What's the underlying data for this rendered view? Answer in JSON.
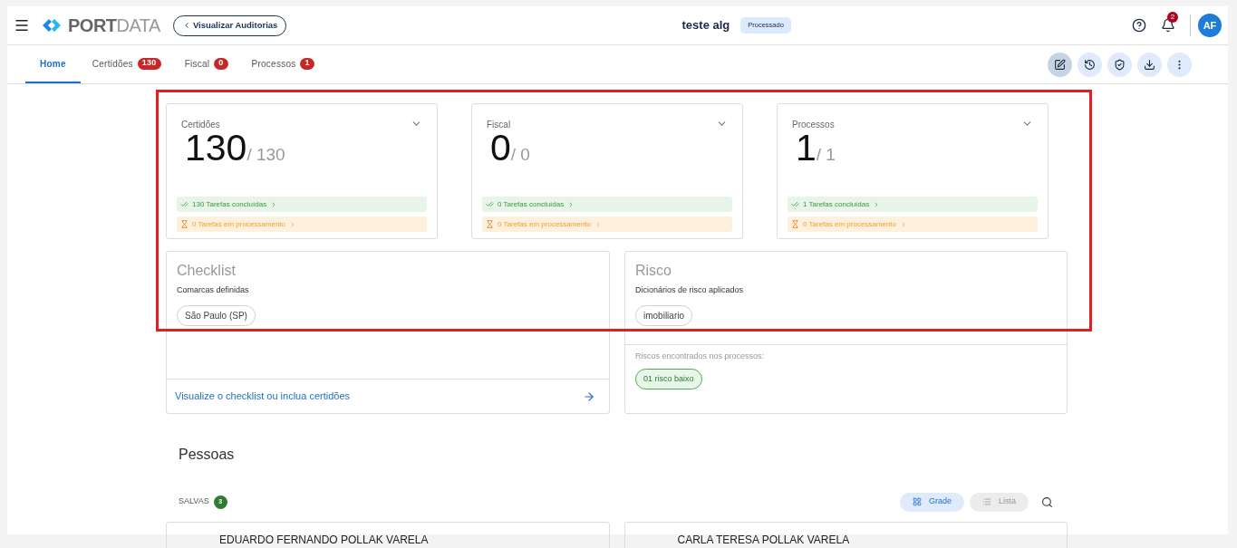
{
  "header": {
    "logo_bold": "PORT",
    "logo_light": "DATA",
    "back_button": "Visualizar Auditorias",
    "title": "teste alg",
    "status": "Processado",
    "notifications": "2",
    "avatar": "AF"
  },
  "tabs": [
    {
      "label": "Home",
      "selected": true
    },
    {
      "label": "Certidões",
      "selected": false,
      "count": "130"
    },
    {
      "label": "Fiscal",
      "selected": false,
      "count": "0"
    },
    {
      "label": "Processos",
      "selected": false,
      "count": "1"
    }
  ],
  "toolbar": [
    {
      "kind": "edit",
      "selected": true
    },
    {
      "kind": "history",
      "selected": false
    },
    {
      "kind": "shield",
      "selected": false
    },
    {
      "kind": "download",
      "selected": false
    },
    {
      "kind": "more",
      "selected": false
    }
  ],
  "stats": [
    {
      "label": "Certidões",
      "value": "130",
      "total": "/ 130",
      "done": "130 Tarefas concluídas",
      "processing": "0 Tarefas em processamento"
    },
    {
      "label": "Fiscal",
      "value": "0",
      "total": "/ 0",
      "done": "0 Tarefas concluídas",
      "processing": "0 Tarefas em processamento"
    },
    {
      "label": "Processos",
      "value": "1",
      "total": "/ 1",
      "done": "1 Tarefas concluídas",
      "processing": "0 Tarefas em processamento"
    }
  ],
  "checklist": {
    "title": "Checklist",
    "subtitle": "Comarcas definidas",
    "chips": [
      "São Paulo (SP)"
    ],
    "link": "Visualize o checklist ou inclua certidões"
  },
  "risco": {
    "title": "Risco",
    "subtitle": "Dicionários de risco aplicados",
    "chips": [
      "imobiliario"
    ],
    "found_label": "Riscos encontrados nos processos:",
    "found": [
      "01 risco baixo"
    ]
  },
  "pessoas": {
    "title": "Pessoas",
    "saved_label": "SALVAS",
    "saved_count": "3",
    "views": [
      {
        "kind": "grid",
        "label": "Grade",
        "selected": true
      },
      {
        "kind": "list",
        "label": "Lista",
        "selected": false
      }
    ],
    "people": [
      "EDUARDO FERNANDO POLLAK VARELA",
      "CARLA TERESA POLLAK VARELA"
    ]
  }
}
